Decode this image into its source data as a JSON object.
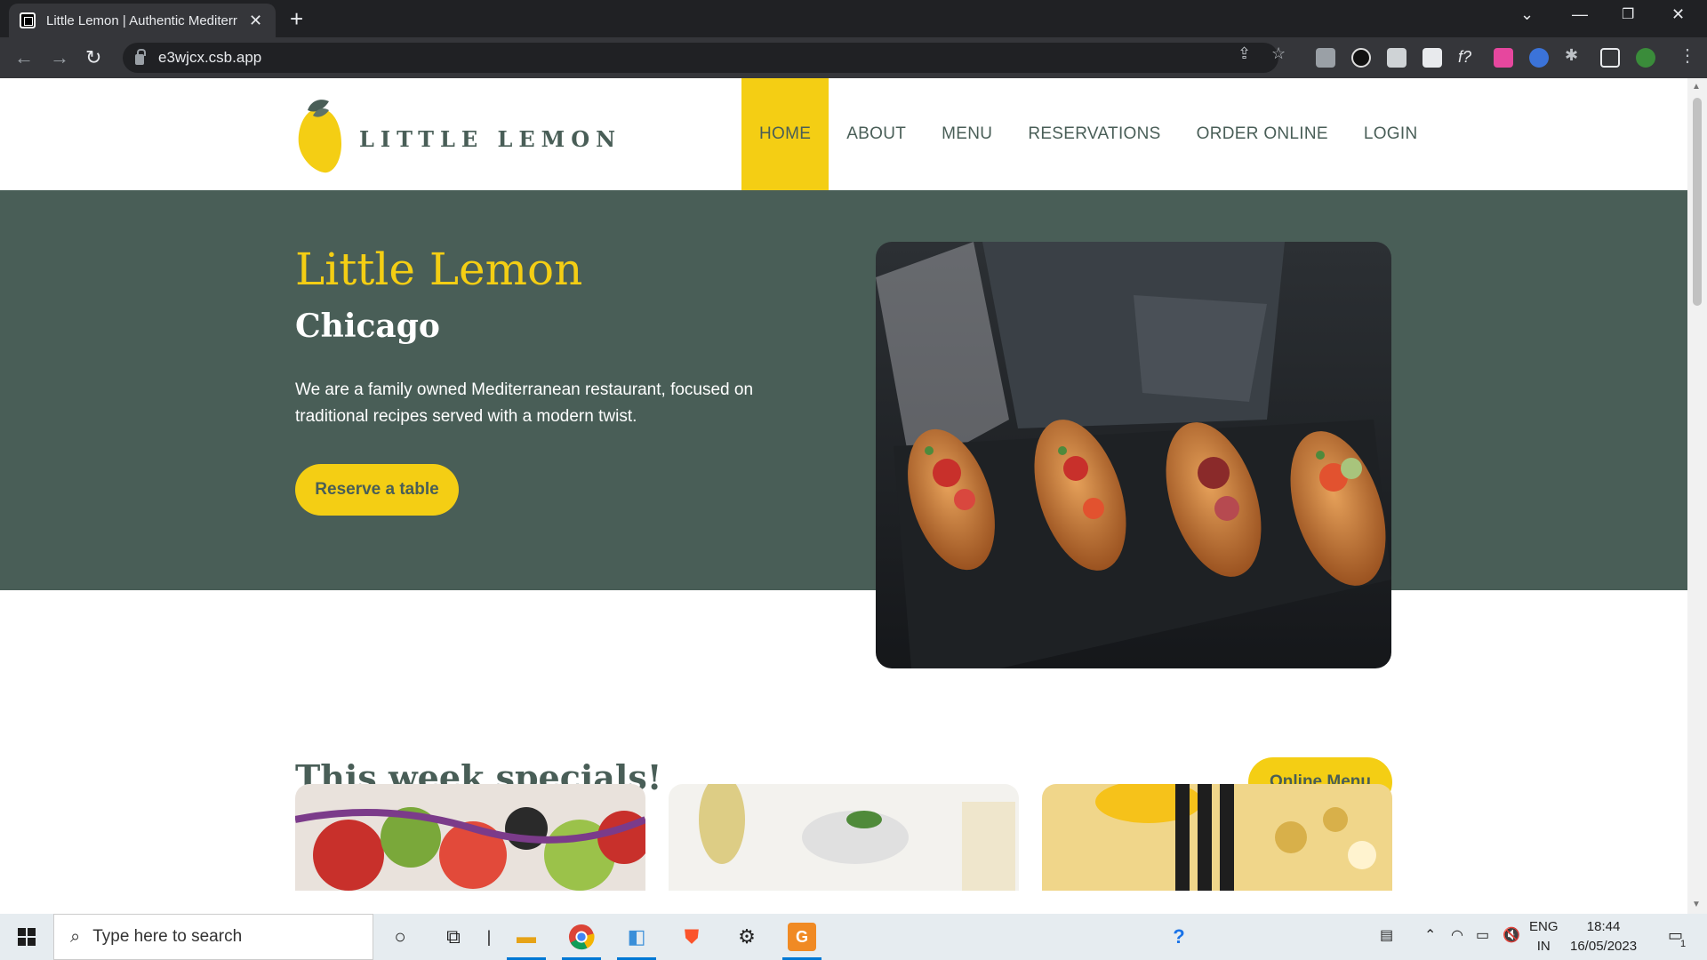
{
  "browser": {
    "tab_title": "Little Lemon | Authentic Mediterr",
    "url": "e3wjcx.csb.app"
  },
  "site": {
    "logo_text": "LITTLE LEMON",
    "nav": [
      {
        "label": "HOME",
        "active": true
      },
      {
        "label": "ABOUT",
        "active": false
      },
      {
        "label": "MENU",
        "active": false
      },
      {
        "label": "RESERVATIONS",
        "active": false
      },
      {
        "label": "ORDER ONLINE",
        "active": false
      },
      {
        "label": "LOGIN",
        "active": false
      }
    ],
    "colors": {
      "primary_green": "#495e57",
      "primary_yellow": "#f4ce14"
    }
  },
  "hero": {
    "title": "Little Lemon",
    "subtitle": "Chicago",
    "description": "We are a family owned Mediterranean restaurant, focused on traditional recipes served with a modern twist.",
    "cta_label": "Reserve a table"
  },
  "specials": {
    "title": "This week specials!",
    "menu_button": "Online Menu"
  },
  "taskbar": {
    "search_placeholder": "Type here to search",
    "language": "ENG",
    "region": "IN",
    "time": "18:44",
    "date": "16/05/2023",
    "notification_count": "1"
  }
}
